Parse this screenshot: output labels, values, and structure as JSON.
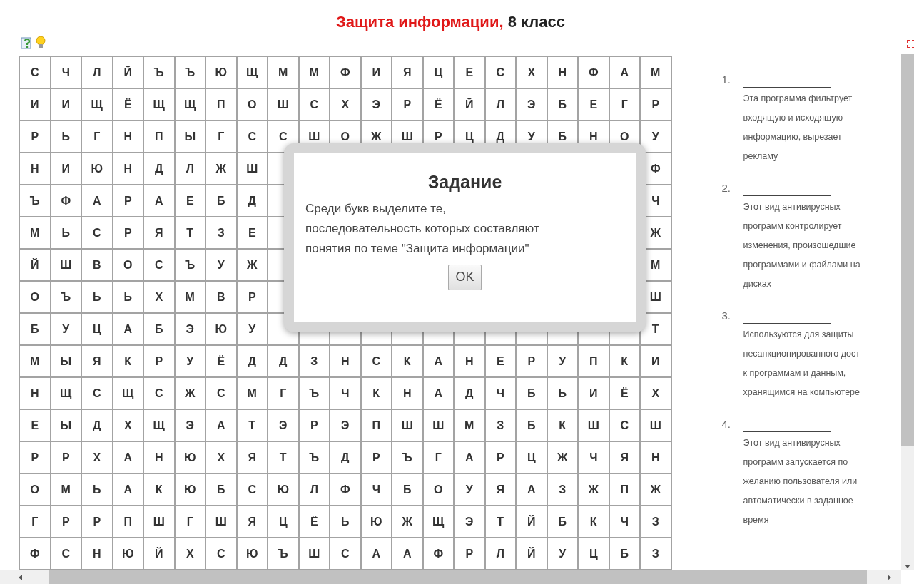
{
  "title": {
    "topic": "Защита информации,",
    "grade": "8 класс"
  },
  "grid": {
    "rows": [
      [
        "С",
        "Ч",
        "Л",
        "Й",
        "Ъ",
        "Ъ",
        "Ю",
        "Щ",
        "М",
        "М",
        "Ф",
        "И",
        "Я",
        "Ц",
        "Е",
        "С",
        "Х",
        "Н",
        "Ф",
        "А",
        "М"
      ],
      [
        "И",
        "И",
        "Щ",
        "Ё",
        "Щ",
        "Щ",
        "П",
        "О",
        "Ш",
        "С",
        "Х",
        "Э",
        "Р",
        "Ё",
        "Й",
        "Л",
        "Э",
        "Б",
        "Е",
        "Г",
        "Р"
      ],
      [
        "Р",
        "Ь",
        "Г",
        "Н",
        "П",
        "Ы",
        "Г",
        "С",
        "С",
        "Ш",
        "О",
        "Ж",
        "Ш",
        "Р",
        "Ц",
        "Д",
        "У",
        "Б",
        "Н",
        "О",
        "У"
      ],
      [
        "Н",
        "И",
        "Ю",
        "Н",
        "Д",
        "Л",
        "Ж",
        "Ш",
        null,
        null,
        null,
        null,
        null,
        null,
        null,
        null,
        null,
        null,
        null,
        null,
        "Ф"
      ],
      [
        "Ъ",
        "Ф",
        "А",
        "Р",
        "А",
        "Е",
        "Б",
        "Д",
        null,
        null,
        null,
        null,
        null,
        null,
        null,
        null,
        null,
        null,
        null,
        null,
        "Ч"
      ],
      [
        "М",
        "Ь",
        "С",
        "Р",
        "Я",
        "Т",
        "З",
        "Е",
        null,
        null,
        null,
        null,
        null,
        null,
        null,
        null,
        null,
        null,
        null,
        null,
        "Ж"
      ],
      [
        "Й",
        "Ш",
        "В",
        "О",
        "С",
        "Ъ",
        "У",
        "Ж",
        null,
        null,
        null,
        null,
        null,
        null,
        null,
        null,
        null,
        null,
        null,
        null,
        "М"
      ],
      [
        "О",
        "Ъ",
        "Ь",
        "Ь",
        "Х",
        "М",
        "В",
        "Р",
        null,
        null,
        null,
        null,
        null,
        null,
        null,
        null,
        null,
        null,
        null,
        null,
        "Ш"
      ],
      [
        "Б",
        "У",
        "Ц",
        "А",
        "Б",
        "Э",
        "Ю",
        "У",
        null,
        null,
        null,
        null,
        null,
        null,
        null,
        null,
        null,
        null,
        null,
        null,
        "Т"
      ],
      [
        "М",
        "Ы",
        "Я",
        "К",
        "Р",
        "У",
        "Ё",
        "Д",
        "Д",
        "З",
        "Н",
        "С",
        "К",
        "А",
        "Н",
        "Е",
        "Р",
        "У",
        "П",
        "К",
        "И"
      ],
      [
        "Н",
        "Щ",
        "С",
        "Щ",
        "С",
        "Ж",
        "С",
        "М",
        "Г",
        "Ъ",
        "Ч",
        "К",
        "Н",
        "А",
        "Д",
        "Ч",
        "Б",
        "Ь",
        "И",
        "Ё",
        "Х"
      ],
      [
        "Е",
        "Ы",
        "Д",
        "Х",
        "Щ",
        "Э",
        "А",
        "Т",
        "Э",
        "Р",
        "Э",
        "П",
        "Ш",
        "Ш",
        "М",
        "З",
        "Б",
        "К",
        "Ш",
        "С",
        "Ш"
      ],
      [
        "Р",
        "Р",
        "Х",
        "А",
        "Н",
        "Ю",
        "Х",
        "Я",
        "Т",
        "Ъ",
        "Д",
        "Р",
        "Ъ",
        "Г",
        "А",
        "Р",
        "Ц",
        "Ж",
        "Ч",
        "Я",
        "Н"
      ],
      [
        "О",
        "М",
        "Ь",
        "А",
        "К",
        "Ю",
        "Б",
        "С",
        "Ю",
        "Л",
        "Ф",
        "Ч",
        "Б",
        "О",
        "У",
        "Я",
        "А",
        "З",
        "Ж",
        "П",
        "Ж"
      ],
      [
        "Г",
        "Р",
        "Р",
        "П",
        "Ш",
        "Г",
        "Ш",
        "Я",
        "Ц",
        "Ё",
        "Ь",
        "Ю",
        "Ж",
        "Щ",
        "Э",
        "Т",
        "Й",
        "Б",
        "К",
        "Ч",
        "З"
      ],
      [
        "Ф",
        "С",
        "Н",
        "Ю",
        "Й",
        "Х",
        "С",
        "Ю",
        "Ъ",
        "Ш",
        "С",
        "А",
        "А",
        "Ф",
        "Р",
        "Л",
        "Й",
        "У",
        "Ц",
        "Б",
        "З"
      ]
    ]
  },
  "questions": [
    {
      "number": "1.",
      "lines": [
        "Эта программа фильтрует",
        "входящую и исходящую",
        "информацию, вырезает",
        "рекламу"
      ]
    },
    {
      "number": "2.",
      "lines": [
        "Этот вид антивирусных",
        "программ контролирует",
        "изменения, произошедшие",
        "программами и файлами на",
        "дисках"
      ]
    },
    {
      "number": "3.",
      "lines": [
        "Используются для защиты",
        "несанкционированного дост",
        "к программам и данным,",
        "хранящимся на компьютере"
      ]
    },
    {
      "number": "4.",
      "lines": [
        "Этот вид антивирусных",
        "программ запускается по",
        "желанию пользователя или",
        "автоматически в заданное",
        "время"
      ]
    }
  ],
  "dialog": {
    "title": "Задание",
    "text": "Среди букв выделите те, последовательность которых составляют понятия по теме \"Защита информации\"",
    "button": "OK"
  }
}
